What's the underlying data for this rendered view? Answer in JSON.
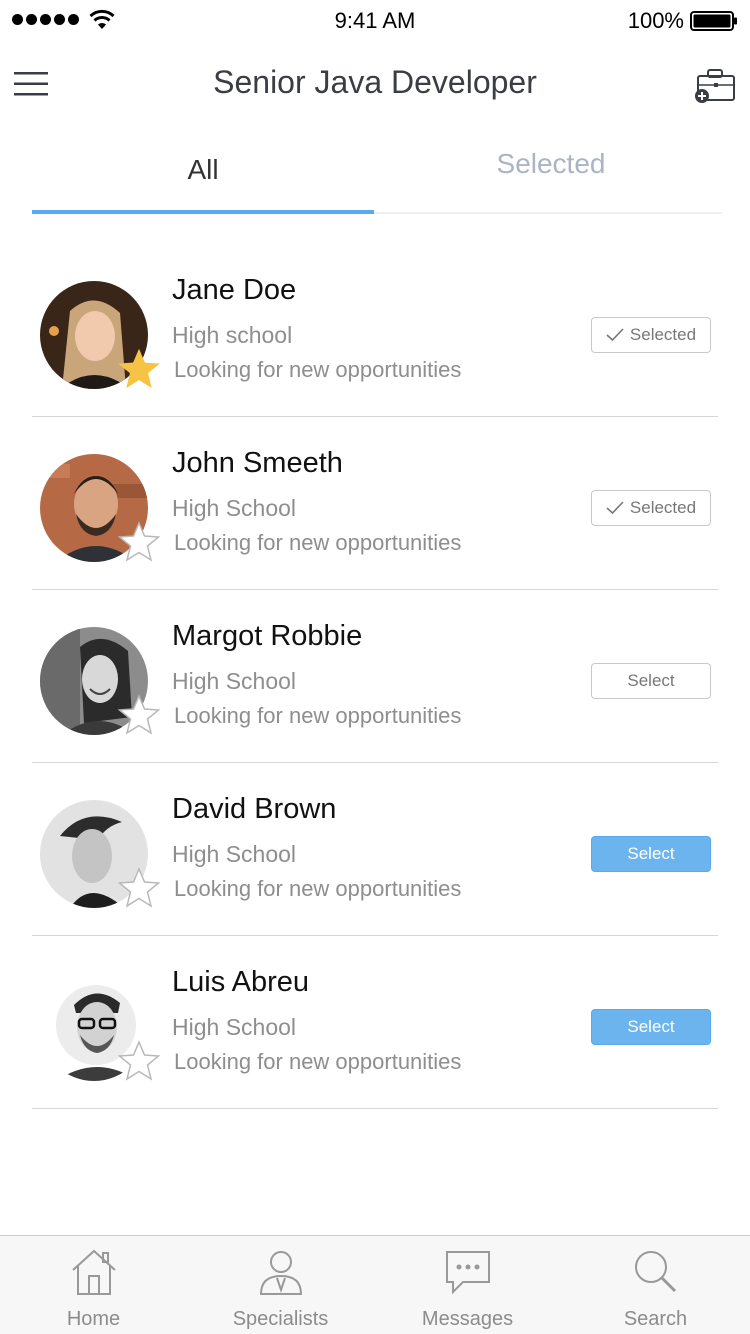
{
  "status_bar": {
    "time": "9:41 AM",
    "battery": "100%"
  },
  "header": {
    "title": "Senior Java Developer"
  },
  "tabs": [
    {
      "label": "All",
      "active": true
    },
    {
      "label": "Selected",
      "active": false
    }
  ],
  "candidates": [
    {
      "name": "Jane Doe",
      "education": "High school",
      "status": "Looking for new opportunities",
      "favorite": true,
      "button": "Selected",
      "button_style": "selected"
    },
    {
      "name": "John Smeeth",
      "education": "High School",
      "status": "Looking for new opportunities",
      "favorite": false,
      "button": "Selected",
      "button_style": "selected"
    },
    {
      "name": "Margot Robbie",
      "education": "High School",
      "status": "Looking for new opportunities",
      "favorite": false,
      "button": "Select",
      "button_style": "outline"
    },
    {
      "name": "David Brown",
      "education": "High School",
      "status": "Looking for new opportunities",
      "favorite": false,
      "button": "Select",
      "button_style": "filled"
    },
    {
      "name": "Luis Abreu",
      "education": "High School",
      "status": "Looking for new opportunities",
      "favorite": false,
      "button": "Select",
      "button_style": "filled"
    }
  ],
  "bottom_nav": [
    {
      "label": "Home",
      "icon": "home-icon"
    },
    {
      "label": "Specialists",
      "icon": "specialist-icon"
    },
    {
      "label": "Messages",
      "icon": "messages-icon"
    },
    {
      "label": "Search",
      "icon": "search-icon"
    }
  ],
  "colors": {
    "accent": "#5aa9ec",
    "button_fill": "#6cb4ee",
    "favorite_star": "#f6c344",
    "muted_text": "#8e8e8e"
  }
}
